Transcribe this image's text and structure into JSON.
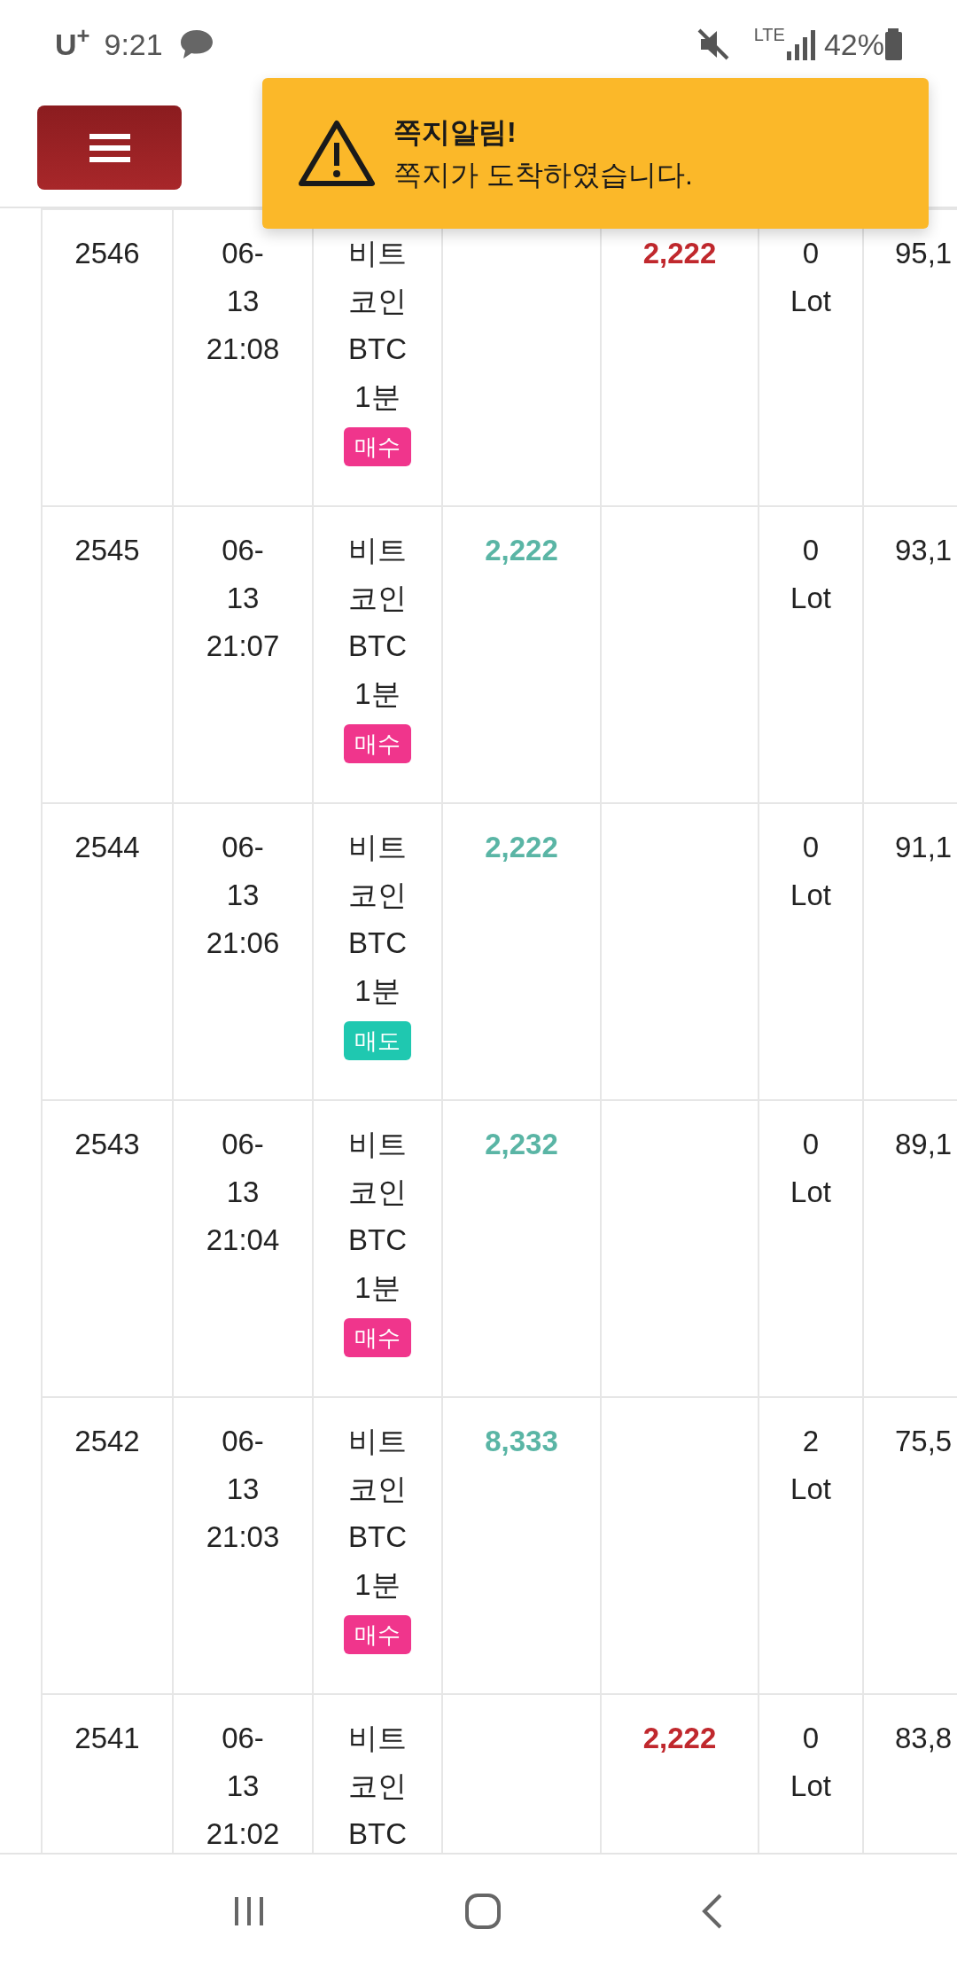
{
  "status_bar": {
    "carrier": "U$^{+}$",
    "time": "9:21",
    "network": "LTE",
    "battery": "42%"
  },
  "toast": {
    "title": "쪽지알림!",
    "message": "쪽지가 도착하였습니다."
  },
  "table": {
    "rows": [
      {
        "id": "2546",
        "date_lines": [
          "06-",
          "13",
          "21:08"
        ],
        "name_lines": [
          "비트",
          "코인",
          "BTC",
          "1분"
        ],
        "side": {
          "label": "매수",
          "kind": "buy"
        },
        "amount": "2,222",
        "loss": true,
        "lot_lines": [
          "0",
          "Lot"
        ],
        "column_7": "95,1"
      },
      {
        "id": "2545",
        "date_lines": [
          "06-",
          "13",
          "21:07"
        ],
        "name_lines": [
          "비트",
          "코인",
          "BTC",
          "1분"
        ],
        "side": {
          "label": "매수",
          "kind": "buy"
        },
        "amount": "2,222",
        "loss": false,
        "lot_lines": [
          "0",
          "Lot"
        ],
        "column_7": "93,1"
      },
      {
        "id": "2544",
        "date_lines": [
          "06-",
          "13",
          "21:06"
        ],
        "name_lines": [
          "비트",
          "코인",
          "BTC",
          "1분"
        ],
        "side": {
          "label": "매도",
          "kind": "sell"
        },
        "amount": "2,222",
        "loss": false,
        "lot_lines": [
          "0",
          "Lot"
        ],
        "column_7": "91,1"
      },
      {
        "id": "2543",
        "date_lines": [
          "06-",
          "13",
          "21:04"
        ],
        "name_lines": [
          "비트",
          "코인",
          "BTC",
          "1분"
        ],
        "side": {
          "label": "매수",
          "kind": "buy"
        },
        "amount": "2,232",
        "loss": false,
        "lot_lines": [
          "0",
          "Lot"
        ],
        "column_7": "89,1"
      },
      {
        "id": "2542",
        "date_lines": [
          "06-",
          "13",
          "21:03"
        ],
        "name_lines": [
          "비트",
          "코인",
          "BTC",
          "1분"
        ],
        "side": {
          "label": "매수",
          "kind": "buy"
        },
        "amount": "8,333",
        "loss": false,
        "lot_lines": [
          "2",
          "Lot"
        ],
        "column_7": "75,5"
      },
      {
        "id": "2541",
        "date_lines": [
          "06-",
          "13",
          "21:02"
        ],
        "name_lines": [
          "비트",
          "코인",
          "BTC"
        ],
        "amount": "2,222",
        "loss": true,
        "lot_lines": [
          "0",
          "Lot"
        ],
        "column_7": "83,8"
      }
    ]
  }
}
